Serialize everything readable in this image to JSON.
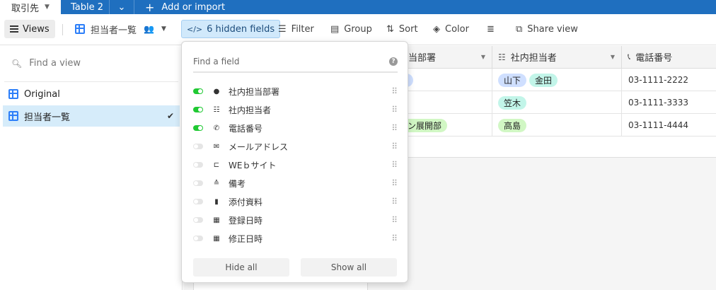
{
  "tabs": {
    "active_label": "取引先",
    "second_label": "Table 2",
    "add_import": "Add or import"
  },
  "toolbar": {
    "views_label": "Views",
    "view_name": "担当者一覧",
    "hidden_fields": "6 hidden fields",
    "filter": "Filter",
    "group": "Group",
    "sort": "Sort",
    "color": "Color",
    "share_view": "Share view"
  },
  "sidebar": {
    "find_placeholder": "Find a view",
    "views": [
      {
        "label": "Original",
        "selected": false
      },
      {
        "label": "担当者一覧",
        "selected": true
      }
    ]
  },
  "grid": {
    "columns": [
      "担当部署",
      "社内担当者",
      "電話番号"
    ],
    "rows": [
      {
        "dept": "業部",
        "dept_color": "#cfdfff",
        "staff": [
          "山下",
          "金田"
        ],
        "phone": "03-1111-2222"
      },
      {
        "dept": "",
        "dept_color": "#d1f7c4",
        "staff": [
          "笠木"
        ],
        "phone": "03-1111-3333"
      },
      {
        "dept": "ション展開部",
        "dept_color": "#d1f7c4",
        "staff": [
          "高島"
        ],
        "phone": "03-1111-4444"
      }
    ]
  },
  "popup": {
    "find_placeholder": "Find a field",
    "fields": [
      {
        "label": "社内担当部署",
        "visible": true,
        "icon": "single-select-icon"
      },
      {
        "label": "社内担当者",
        "visible": true,
        "icon": "multi-select-icon"
      },
      {
        "label": "電話番号",
        "visible": true,
        "icon": "phone-icon"
      },
      {
        "label": "メールアドレス",
        "visible": false,
        "icon": "email-icon"
      },
      {
        "label": "WEｂサイト",
        "visible": false,
        "icon": "url-icon"
      },
      {
        "label": "備考",
        "visible": false,
        "icon": "long-text-icon"
      },
      {
        "label": "添付資料",
        "visible": false,
        "icon": "attachment-icon"
      },
      {
        "label": "登録日時",
        "visible": false,
        "icon": "created-time-icon"
      },
      {
        "label": "修正日時",
        "visible": false,
        "icon": "modified-time-icon"
      }
    ],
    "hide_all": "Hide all",
    "show_all": "Show all"
  },
  "colors": {
    "topbar": "#1f6fbf",
    "accent_blue": "#2d7ff9",
    "toggle_on": "#20c933",
    "selected_view_bg": "#d6ecfa"
  }
}
